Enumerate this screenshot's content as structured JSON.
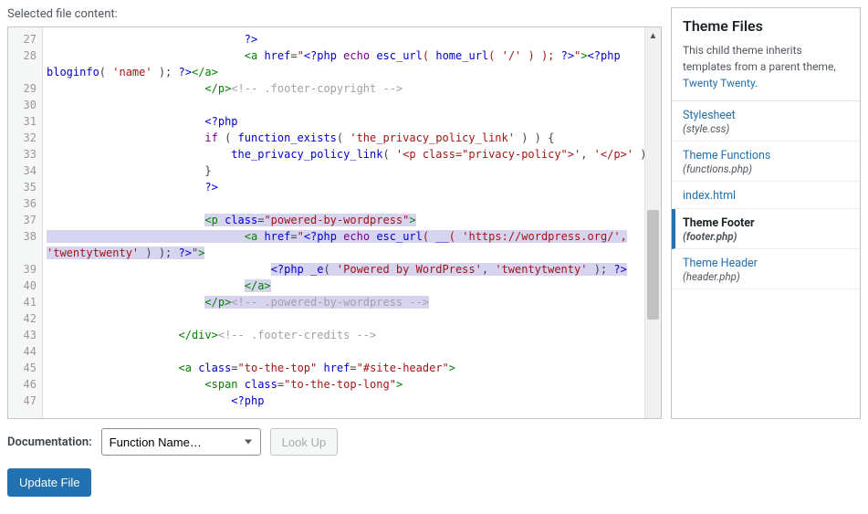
{
  "header": {
    "title": "Selected file content:",
    "side_title": "Theme Files"
  },
  "theme_note": {
    "text_before": "This child theme inherits templates from a parent theme, ",
    "link": "Twenty Twenty",
    "text_after": "."
  },
  "files": [
    {
      "label": "Stylesheet",
      "sub": "(style.css)"
    },
    {
      "label": "Theme Functions",
      "sub": "(functions.php)"
    },
    {
      "label": "index.html",
      "sub": ""
    },
    {
      "label": "Theme Footer",
      "sub": "(footer.php)"
    },
    {
      "label": "Theme Header",
      "sub": "(header.php)"
    }
  ],
  "docs": {
    "label": "Documentation:",
    "select": "Function Name…",
    "lookup": "Look Up"
  },
  "update": {
    "label": "Update File"
  },
  "code": {
    "first_line": 27,
    "lines": [
      {
        "n": 27,
        "html": "                              <span class='php'>?&gt;</span>"
      },
      {
        "n": 28,
        "html": "                              <span class='tag'>&lt;a</span> <span class='attr'>href</span>=<span class='str'>\"<span class='php'>&lt;?php</span> <span class='kw'>echo</span> <span class='fn'>esc_url</span>( <span class='fn'>home_url</span>( <span class='str'>'/'</span> ) ); <span class='php'>?&gt;</span>\"</span><span class='tag'>&gt;</span><span class='php'>&lt;?php</span>",
        "wrap": "<span class='fn'>bloginfo</span>( <span class='str'>'name'</span> ); <span class='php'>?&gt;</span><span class='tag'>&lt;/a&gt;</span>"
      },
      {
        "n": 29,
        "html": "                        <span class='tag'>&lt;/p&gt;</span><span class='cmt'>&lt;!-- .footer-copyright --&gt;</span>"
      },
      {
        "n": 30,
        "html": ""
      },
      {
        "n": 31,
        "html": "                        <span class='php'>&lt;?php</span>"
      },
      {
        "n": 32,
        "html": "                        <span class='kw'>if</span> ( <span class='fn'>function_exists</span>( <span class='str'>'the_privacy_policy_link'</span> ) ) {"
      },
      {
        "n": 33,
        "html": "                            <span class='fn'>the_privacy_policy_link</span>( <span class='str'>'&lt;p class=\"privacy-policy\"&gt;'</span>, <span class='str'>'&lt;/p&gt;'</span> );"
      },
      {
        "n": 34,
        "html": "                        }"
      },
      {
        "n": 35,
        "html": "                        <span class='php'>?&gt;</span>"
      },
      {
        "n": 36,
        "html": ""
      },
      {
        "n": 37,
        "html": "                        <span class='sel'><span class='tag'>&lt;p</span> <span class='attr'>class</span>=<span class='str'>\"powered-by-wordpress\"</span><span class='tag'>&gt;</span></span>",
        "selrow": true
      },
      {
        "n": 38,
        "html": "<span class='sel'>                              <span class='tag'>&lt;a</span> <span class='attr'>href</span>=<span class='str'>\"<span class='php'>&lt;?php</span> <span class='kw'>echo</span> <span class='fn'>esc_url</span>( <span class='fn'>__</span>( <span class='str'>'https://wordpress.org/'</span>,</span>",
        "wrap": "<span class='sel'><span class='str'>'twentytwenty'</span> ) ); <span class='php'>?&gt;</span>\"<span class='tag'>&gt;</span></span>",
        "selrow": true
      },
      {
        "n": 39,
        "html": "                                  <span class='sel'><span class='php'>&lt;?php</span> <span class='fn'>_e</span>( <span class='str'>'Powered by WordPress'</span>, <span class='str'>'twentytwenty'</span> ); <span class='php'>?&gt;</span></span>",
        "selrow": true
      },
      {
        "n": 40,
        "html": "                              <span class='sel'><span class='tag'>&lt;/a&gt;</span></span>",
        "selrow": true
      },
      {
        "n": 41,
        "html": "                        <span class='sel'><span class='tag'>&lt;/p&gt;</span><span class='cmt'>&lt;!-- .powered-by-wordpress --&gt;</span></span>",
        "selrow": true
      },
      {
        "n": 42,
        "html": ""
      },
      {
        "n": 43,
        "html": "                    <span class='tag'>&lt;/div&gt;</span><span class='cmt'>&lt;!-- .footer-credits --&gt;</span>"
      },
      {
        "n": 44,
        "html": ""
      },
      {
        "n": 45,
        "html": "                    <span class='tag'>&lt;a</span> <span class='attr'>class</span>=<span class='str'>\"to-the-top\"</span> <span class='attr'>href</span>=<span class='str'>\"#site-header\"</span><span class='tag'>&gt;</span>"
      },
      {
        "n": 46,
        "html": "                        <span class='tag'>&lt;span</span> <span class='attr'>class</span>=<span class='str'>\"to-the-top-long\"</span><span class='tag'>&gt;</span>"
      },
      {
        "n": 47,
        "html": "                            <span class='php'>&lt;?php</span>"
      }
    ]
  }
}
